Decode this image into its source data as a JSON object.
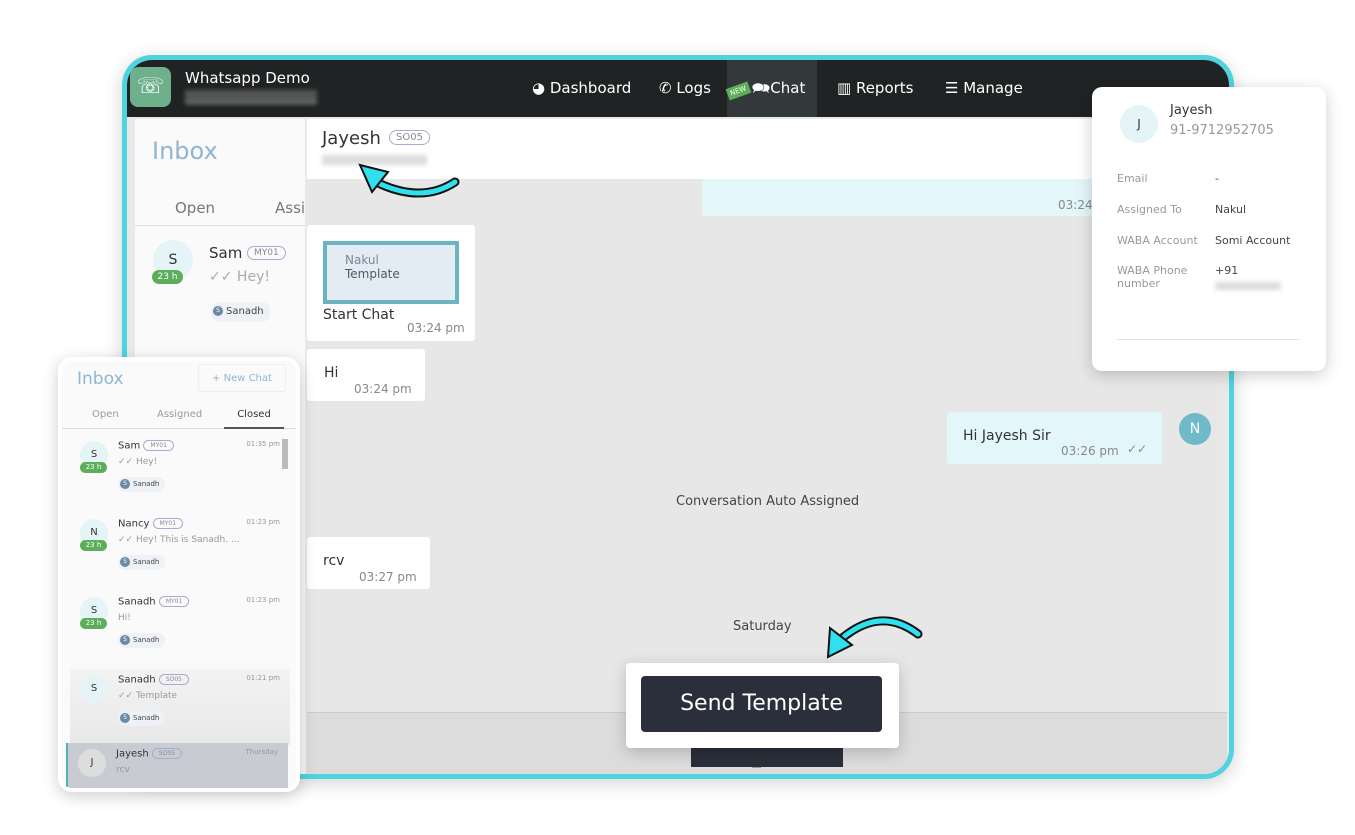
{
  "app": {
    "title": "Whatsapp Demo"
  },
  "nav": {
    "items": [
      {
        "label": "Dashboard",
        "icon": "pie-chart-icon"
      },
      {
        "label": "Logs",
        "icon": "phone-icon"
      },
      {
        "label": "Chat",
        "icon": "chat-icon",
        "badge": "NEW",
        "active": true
      },
      {
        "label": "Reports",
        "icon": "bar-chart-icon"
      },
      {
        "label": "Manage",
        "icon": "menu-icon"
      }
    ]
  },
  "sidebar": {
    "title": "Inbox",
    "tabs": [
      "Open",
      "Assi"
    ],
    "item": {
      "initial": "S",
      "name": "Sam",
      "tag": "MY01",
      "hours": "23 h",
      "preview": "Hey!",
      "agent": "Sanadh",
      "agent_initial": "S"
    }
  },
  "chat": {
    "contact": "Jayesh",
    "tag": "SO05",
    "messages": [
      {
        "time": "03:24"
      },
      {
        "template_name": "Nakul",
        "template_label": "Template",
        "text": "Start Chat",
        "time": "03:24 pm"
      },
      {
        "text": "Hi",
        "time": "03:24 pm"
      },
      {
        "text": "Hi Jayesh Sir",
        "time": "03:26 pm",
        "sender_initial": "N"
      },
      {
        "system": "Conversation Auto Assigned"
      },
      {
        "text": "rcv",
        "time": "03:27 pm"
      },
      {
        "system": "Saturday"
      }
    ]
  },
  "send_template": {
    "label": "Send Template"
  },
  "contact_card": {
    "initial": "J",
    "name": "Jayesh",
    "phone": "91-9712952705",
    "fields": [
      {
        "label": "Email",
        "value": "-"
      },
      {
        "label": "Assigned To",
        "value": "Nakul"
      },
      {
        "label": "WABA Account",
        "value": "Somi Account"
      },
      {
        "label": "WABA Phone number",
        "value": "+91"
      }
    ]
  },
  "inbox_panel": {
    "title": "Inbox",
    "new_chat": "+ New Chat",
    "tabs": [
      "Open",
      "Assigned",
      "Closed"
    ],
    "active_tab": "Closed",
    "items": [
      {
        "initial": "S",
        "name": "Sam",
        "tag": "MY01",
        "hours": "23 h",
        "preview": "Hey!",
        "time": "01:35 pm",
        "agent": "Sanadh"
      },
      {
        "initial": "N",
        "name": "Nancy",
        "tag": "MY01",
        "hours": "23 h",
        "preview": "Hey! This is Sanadh. ...",
        "time": "01:23 pm",
        "agent": "Sanadh"
      },
      {
        "initial": "S",
        "name": "Sanadh",
        "tag": "MY01",
        "hours": "23 h",
        "preview": "Hi!",
        "time": "01:23 pm",
        "agent": "Sanadh"
      },
      {
        "initial": "S",
        "name": "Sanadh",
        "tag": "SO05",
        "hours": "",
        "preview": "Template",
        "time": "01:21 pm",
        "agent": "Sanadh"
      },
      {
        "initial": "J",
        "name": "Jayesh",
        "tag": "SO05",
        "hours": "",
        "preview": "rcv",
        "time": "Thursday",
        "agent": ""
      }
    ]
  },
  "colors": {
    "accent": "#4fd3df",
    "nav": "#202324",
    "green": "#5cae5a",
    "button": "#2a2f3b"
  }
}
